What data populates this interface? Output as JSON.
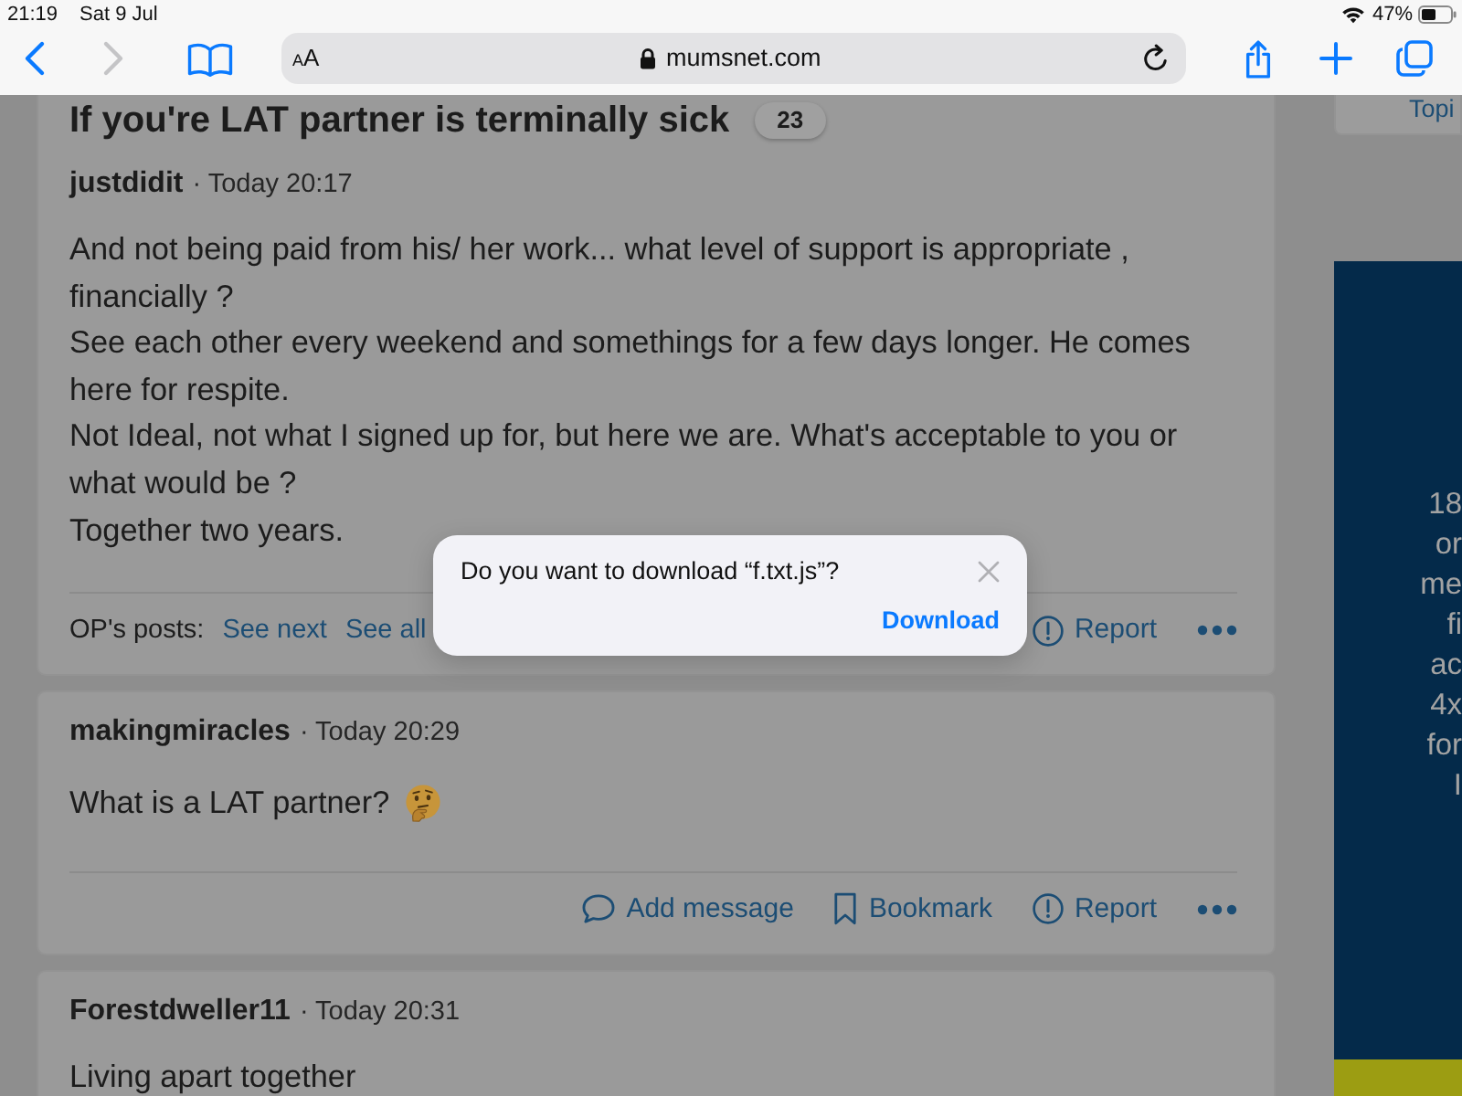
{
  "status_bar": {
    "time": "21:19",
    "date": "Sat 9 Jul",
    "battery_text": "47%"
  },
  "toolbar": {
    "back_disabled": false,
    "forward_disabled": true,
    "text_size_button": "AA",
    "address": "mumsnet.com"
  },
  "thread": {
    "title": "If you're LAT partner is terminally sick",
    "reply_count": "23"
  },
  "posts": [
    {
      "author": "justdidit",
      "time": "· Today 20:17",
      "body": [
        "And not being paid from his/ her work... what level of support is appropriate , financially ?",
        "See each other every weekend and somethings for a few days longer. He comes here for respite.",
        "Not Ideal, not what I signed up for, but here we are. What's acceptable to you or what would be ?",
        "Together two years."
      ],
      "op_posts": {
        "label": "OP's posts:",
        "links": [
          "See next",
          "See all"
        ]
      },
      "actions": [
        {
          "kind": "report",
          "label": "Report"
        }
      ],
      "more_menu": true
    },
    {
      "author": "makingmiracles",
      "time": "· Today 20:29",
      "body": [
        "What is a LAT partner?"
      ],
      "emoji": true,
      "actions": [
        {
          "kind": "add_message",
          "label": "Add message"
        },
        {
          "kind": "bookmark",
          "label": "Bookmark"
        },
        {
          "kind": "report",
          "label": "Report"
        }
      ],
      "more_menu": true
    },
    {
      "author": "Forestdweller11",
      "time": "· Today 20:31",
      "body": [
        "Living apart together"
      ]
    }
  ],
  "sidebar": {
    "topic_card": "Topi",
    "ad_lines": [
      "18",
      "or",
      "me",
      "fi",
      "ac",
      "4x",
      "for",
      "I"
    ]
  },
  "dialog": {
    "message": "Do you want to download “f.txt.js”?",
    "button": "Download"
  }
}
